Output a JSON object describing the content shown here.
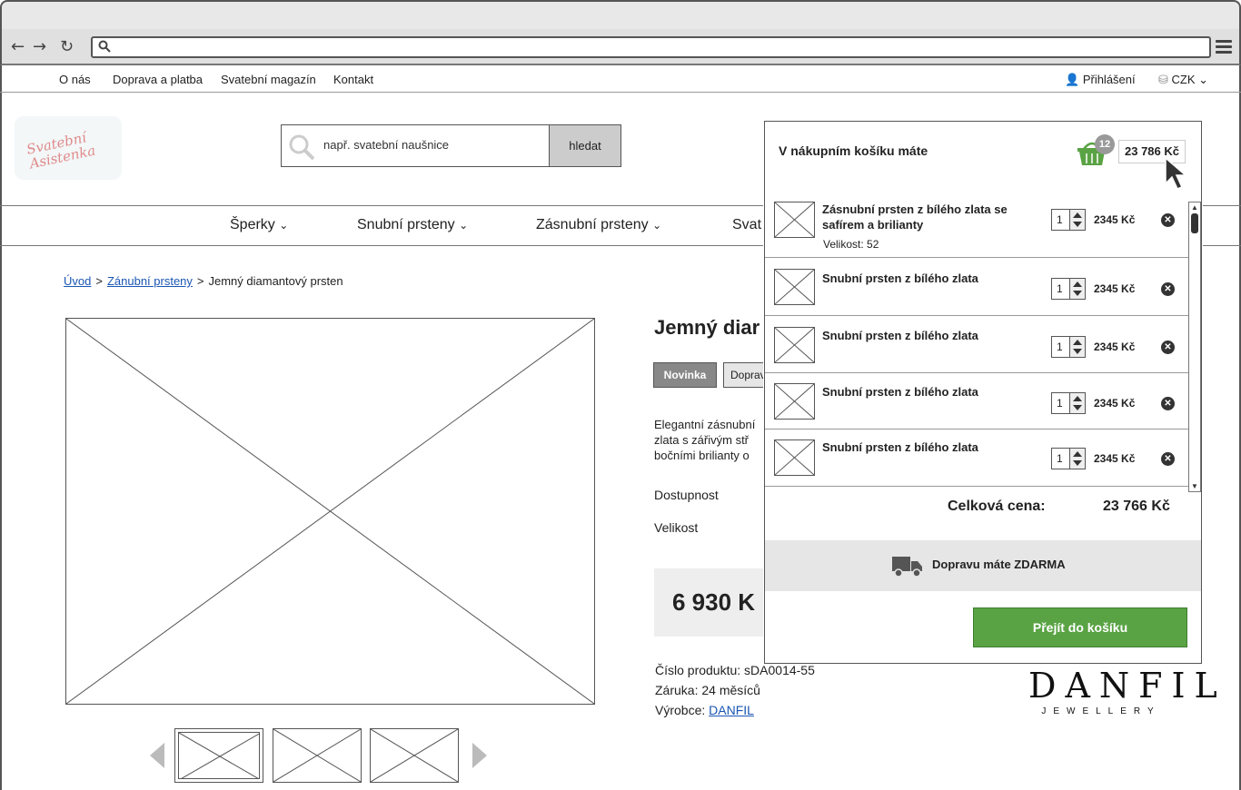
{
  "topbar": {
    "links": [
      "O nás",
      "Doprava a platba",
      "Svatební magazín",
      "Kontakt"
    ],
    "login": "Přihlášení",
    "currency": "CZK"
  },
  "header": {
    "logo_text": "Svatební Asistenka",
    "search_placeholder": "např. svatební naušnice",
    "search_button": "hledat"
  },
  "nav": {
    "items": [
      "Šperky",
      "Snubní prsteny",
      "Zásnubní prsteny",
      "Svat"
    ]
  },
  "breadcrumb": {
    "home": "Úvod",
    "category": "Zánubní prsteny",
    "current": "Jemný diamantový prsten"
  },
  "product": {
    "title": "Jemný diar",
    "badge_new": "Novinka",
    "badge_other": "Doprav",
    "description_lines": [
      "Elegantní zásnubní",
      "zlata s zářivým stř",
      "bočními brilianty o"
    ],
    "availability_label": "Dostupnost",
    "size_label": "Velikost",
    "price": "6 930 K",
    "product_number": "Číslo produktu: sDA0014-55",
    "warranty": "Záruka: 24 měsíců",
    "manufacturer_label": "Výrobce:",
    "manufacturer": "DANFIL"
  },
  "brand": {
    "name": "DANFIL",
    "tagline": "JEWELLERY"
  },
  "cart": {
    "heading": "V nákupním košíku máte",
    "count": "12",
    "total_top": "23 786 Kč",
    "items": [
      {
        "name": "Zásnubní prsten z bílého zlata se safírem a brilianty",
        "size": "Velikost: 52",
        "qty": "1",
        "price": "2345 Kč"
      },
      {
        "name": "Snubní prsten z bílého zlata",
        "size": "",
        "qty": "1",
        "price": "2345 Kč"
      },
      {
        "name": "Snubní prsten z bílého zlata",
        "size": "",
        "qty": "1",
        "price": "2345 Kč"
      },
      {
        "name": "Snubní prsten z bílého zlata",
        "size": "",
        "qty": "1",
        "price": "2345 Kč"
      },
      {
        "name": "Snubní prsten z bílého zlata",
        "size": "",
        "qty": "1",
        "price": "2345 Kč"
      }
    ],
    "total_label": "Celková cena:",
    "total_value": "23 766 Kč",
    "shipping_text": "Dopravu máte ZDARMA",
    "checkout_button": "Přejít do košíku"
  },
  "colors": {
    "accent_green": "#5aa345",
    "link_blue": "#1a56b3"
  }
}
